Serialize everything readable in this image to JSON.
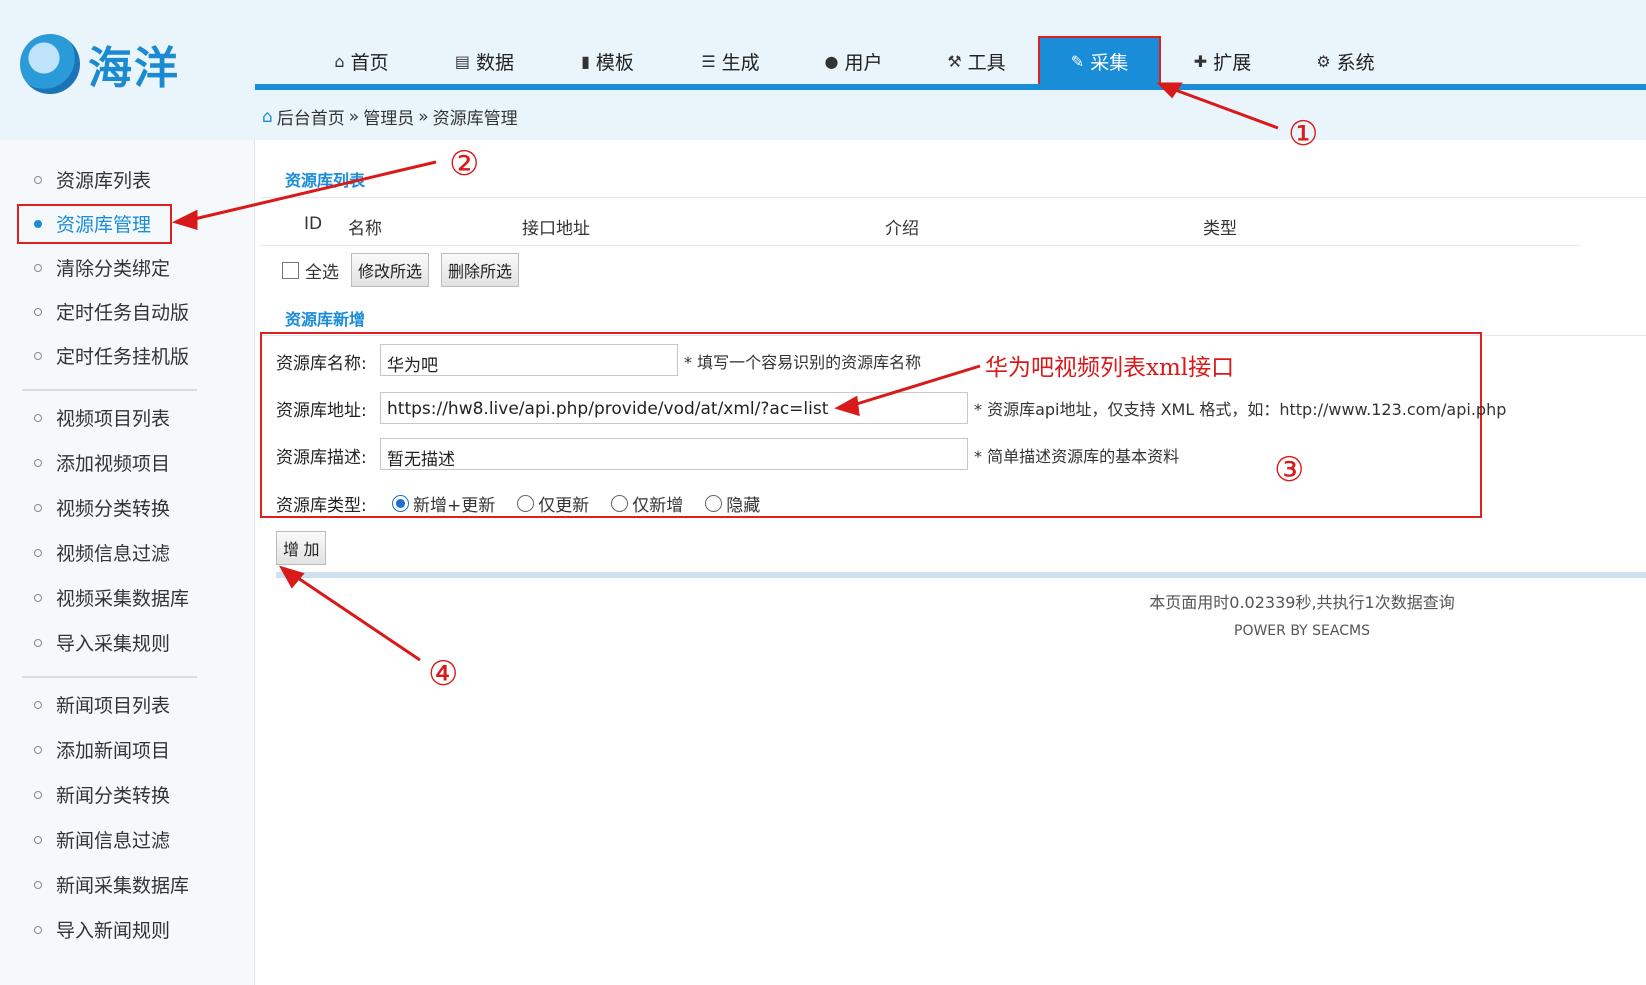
{
  "logo": {
    "text": "海洋"
  },
  "topnav": [
    {
      "label": "首页",
      "icon": "home-icon"
    },
    {
      "label": "数据",
      "icon": "database-icon"
    },
    {
      "label": "模板",
      "icon": "file-icon"
    },
    {
      "label": "生成",
      "icon": "server-icon"
    },
    {
      "label": "用户",
      "icon": "user-icon"
    },
    {
      "label": "工具",
      "icon": "wrench-icon"
    },
    {
      "label": "采集",
      "icon": "edit-icon",
      "active": true
    },
    {
      "label": "扩展",
      "icon": "puzzle-icon"
    },
    {
      "label": "系统",
      "icon": "gear-icon"
    }
  ],
  "breadcrumb": {
    "home": "后台首页",
    "level2": "管理员",
    "current": "资源库管理",
    "sep": "»"
  },
  "sidebar": {
    "items": [
      "资源库列表",
      "资源库管理",
      "清除分类绑定",
      "定时任务自动版",
      "定时任务挂机版",
      "视频项目列表",
      "添加视频项目",
      "视频分类转换",
      "视频信息过滤",
      "视频采集数据库",
      "导入采集规则",
      "新闻项目列表",
      "添加新闻项目",
      "新闻分类转换",
      "新闻信息过滤",
      "新闻采集数据库",
      "导入新闻规则"
    ],
    "active": "资源库管理"
  },
  "list_section": {
    "title": "资源库列表",
    "columns": [
      "ID",
      "名称",
      "接口地址",
      "介绍",
      "类型"
    ],
    "select_all": "全选",
    "edit_selected": "修改所选",
    "delete_selected": "删除所选"
  },
  "add_section": {
    "title": "资源库新增",
    "name_label": "资源库名称:",
    "name_value": "华为吧",
    "name_hint": "* 填写一个容易识别的资源库名称",
    "url_label": "资源库地址:",
    "url_value": "https://hw8.live/api.php/provide/vod/at/xml/?ac=list",
    "url_hint": "* 资源库api地址，仅支持 XML 格式，如：http://www.123.com/api.php",
    "desc_label": "资源库描述:",
    "desc_value": "暂无描述",
    "desc_hint": "* 简单描述资源库的基本资料",
    "type_label": "资源库类型:",
    "type_options": [
      "新增+更新",
      "仅更新",
      "仅新增",
      "隐藏"
    ],
    "type_selected": "新增+更新",
    "submit": "增 加"
  },
  "footer": {
    "timing": "本页面用时0.02339秒,共执行1次数据查询",
    "power": "POWER BY SEACMS"
  },
  "annotations": {
    "n1": "①",
    "n2": "②",
    "n3": "③",
    "n4": "④",
    "note": "华为吧视频列表xml接口"
  },
  "colors": {
    "accent": "#1a8dd8",
    "annotation": "#d81a1a"
  }
}
